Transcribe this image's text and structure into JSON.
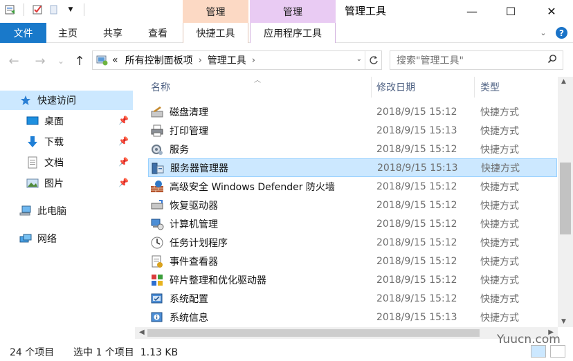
{
  "window": {
    "title": "管理工具",
    "context_tab1": "管理",
    "context_tab2": "管理",
    "minimize_glyph": "—",
    "maximize_glyph": "☐",
    "close_glyph": "✕"
  },
  "ribbon": {
    "file_label": "文件",
    "tabs": [
      "主页",
      "共享",
      "查看"
    ],
    "context_sub1": "快捷工具",
    "context_sub2": "应用程序工具",
    "expand_glyph": "⌄",
    "help_glyph": "?"
  },
  "navigation": {
    "back_glyph": "←",
    "forward_glyph": "→",
    "history_glyph": "⌄",
    "up_glyph": "↑",
    "overflow": "«",
    "breadcrumb": [
      "所有控制面板项",
      "管理工具"
    ],
    "separator": "›",
    "search_placeholder": "搜索\"管理工具\""
  },
  "sidebar": {
    "items": [
      {
        "label": "快速访问",
        "icon": "star-icon",
        "pinned": false,
        "selected": true
      },
      {
        "label": "桌面",
        "icon": "desktop-icon",
        "pinned": true
      },
      {
        "label": "下载",
        "icon": "download-icon",
        "pinned": true
      },
      {
        "label": "文档",
        "icon": "document-icon",
        "pinned": true
      },
      {
        "label": "图片",
        "icon": "picture-icon",
        "pinned": true
      },
      {
        "label": "此电脑",
        "icon": "computer-icon",
        "pinned": false
      },
      {
        "label": "网络",
        "icon": "network-icon",
        "pinned": false
      }
    ]
  },
  "columns": {
    "name": "名称",
    "date": "修改日期",
    "type": "类型"
  },
  "files": [
    {
      "name": "磁盘清理",
      "date": "2018/9/15 15:12",
      "type": "快捷方式",
      "icon": "disk-cleanup-icon"
    },
    {
      "name": "打印管理",
      "date": "2018/9/15 15:13",
      "type": "快捷方式",
      "icon": "printer-icon"
    },
    {
      "name": "服务",
      "date": "2018/9/15 15:12",
      "type": "快捷方式",
      "icon": "services-gear-icon"
    },
    {
      "name": "服务器管理器",
      "date": "2018/9/15 15:13",
      "type": "快捷方式",
      "icon": "server-manager-icon",
      "selected": true
    },
    {
      "name": "高级安全 Windows Defender 防火墙",
      "date": "2018/9/15 15:12",
      "type": "快捷方式",
      "icon": "firewall-icon"
    },
    {
      "name": "恢复驱动器",
      "date": "2018/9/15 15:12",
      "type": "快捷方式",
      "icon": "recovery-drive-icon"
    },
    {
      "name": "计算机管理",
      "date": "2018/9/15 15:12",
      "type": "快捷方式",
      "icon": "computer-management-icon"
    },
    {
      "name": "任务计划程序",
      "date": "2018/9/15 15:12",
      "type": "快捷方式",
      "icon": "task-scheduler-icon"
    },
    {
      "name": "事件查看器",
      "date": "2018/9/15 15:12",
      "type": "快捷方式",
      "icon": "event-viewer-icon"
    },
    {
      "name": "碎片整理和优化驱动器",
      "date": "2018/9/15 15:12",
      "type": "快捷方式",
      "icon": "defrag-icon"
    },
    {
      "name": "系统配置",
      "date": "2018/9/15 15:12",
      "type": "快捷方式",
      "icon": "system-config-icon"
    },
    {
      "name": "系统信息",
      "date": "2018/9/15 15:13",
      "type": "快捷方式",
      "icon": "system-info-icon"
    }
  ],
  "status": {
    "item_count": "24 个项目",
    "selection": "选中 1 个项目  1.13 KB"
  },
  "watermark": "Yuucn.com",
  "colors": {
    "file_tab": "#1979ca",
    "context1": "#fcd9c4",
    "context2": "#e9cbf3",
    "selection": "#cce8ff",
    "selection_border": "#99d1ff"
  }
}
